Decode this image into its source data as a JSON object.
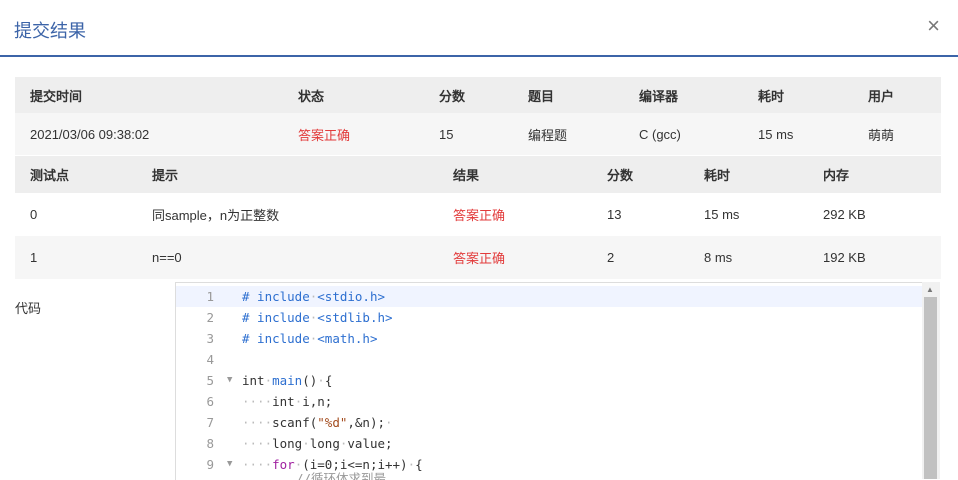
{
  "dialog": {
    "title": "提交结果",
    "close_label": "×"
  },
  "submission": {
    "headers": {
      "time": "提交时间",
      "status": "状态",
      "score": "分数",
      "problem": "题目",
      "compiler": "编译器",
      "elapsed": "耗时",
      "user": "用户"
    },
    "row": {
      "time": "2021/03/06 09:38:02",
      "status": "答案正确",
      "score": "15",
      "problem": "编程题",
      "compiler": "C (gcc)",
      "elapsed": "15 ms",
      "user": "萌萌"
    }
  },
  "tests": {
    "headers": {
      "case": "测试点",
      "hint": "提示",
      "result": "结果",
      "score": "分数",
      "elapsed": "耗时",
      "memory": "内存"
    },
    "rows": [
      {
        "case": "0",
        "hint": "同sample，n为正整数",
        "result": "答案正确",
        "score": "13",
        "elapsed": "15 ms",
        "memory": "292 KB"
      },
      {
        "case": "1",
        "hint": "n==0",
        "result": "答案正确",
        "score": "2",
        "elapsed": "8 ms",
        "memory": "192 KB"
      }
    ]
  },
  "code": {
    "label": "代码",
    "lines": [
      "1",
      "2",
      "3",
      "4",
      "5",
      "6",
      "7",
      "8",
      "9"
    ],
    "next_line_partial": "//循环体求到最"
  },
  "colors": {
    "accent": "#3c64a8",
    "success_text": "#e23b3b"
  }
}
